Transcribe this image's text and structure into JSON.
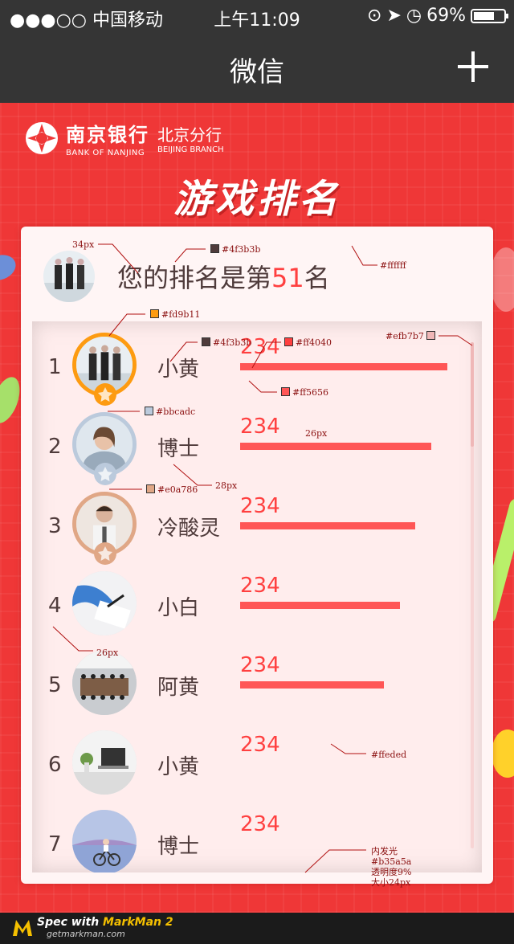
{
  "status_bar": {
    "carrier": "●●●○○ 中国移动",
    "time": "上午11:09",
    "battery": "69%",
    "battery_level": 0.69
  },
  "nav": {
    "title": "微信"
  },
  "bank": {
    "name_cn": "南京银行",
    "name_en": "BANK OF NANJING",
    "branch_cn": "北京分行",
    "branch_en": "BEIJING BRANCH"
  },
  "page_title": "游戏排名",
  "my_rank": {
    "prefix": "您的排名是第",
    "rank": "51",
    "suffix": "名"
  },
  "ranking": [
    {
      "rank": "1",
      "name": "小黄",
      "score": "234",
      "bar_fraction": 0.92,
      "medal": "gold"
    },
    {
      "rank": "2",
      "name": "博士",
      "score": "234",
      "bar_fraction": 0.85,
      "medal": "silver"
    },
    {
      "rank": "3",
      "name": "冷酸灵",
      "score": "234",
      "bar_fraction": 0.78,
      "medal": "bronze"
    },
    {
      "rank": "4",
      "name": "小白",
      "score": "234",
      "bar_fraction": 0.71,
      "medal": ""
    },
    {
      "rank": "5",
      "name": "阿黄",
      "score": "234",
      "bar_fraction": 0.64,
      "medal": ""
    },
    {
      "rank": "6",
      "name": "小黄",
      "score": "234",
      "bar_fraction": 0,
      "medal": ""
    },
    {
      "rank": "7",
      "name": "博士",
      "score": "234",
      "bar_fraction": 0,
      "medal": ""
    }
  ],
  "colors": {
    "text": "#4f3b3b",
    "score": "#ff4040",
    "bar": "#ff5656",
    "panel": "#ffffff",
    "list_bg": "#ffeded",
    "scrollbar": "#efb7b7",
    "gold": "#fd9b11",
    "silver": "#bbcadc",
    "bronze": "#e0a786"
  },
  "annotations": {
    "a_34px": "34px",
    "a_4f3b3b_1": "#4f3b3b",
    "a_ffffff": "#ffffff",
    "a_fd9b11": "#fd9b11",
    "a_4f3b3b_2": "#4f3b3b",
    "a_ff4040": "#ff4040",
    "a_efb7b7": "#efb7b7",
    "a_ff5656": "#ff5656",
    "a_bbcadc": "#bbcadc",
    "a_26px_1": "26px",
    "a_e0a786": "#e0a786",
    "a_28px": "28px",
    "a_26px_2": "26px",
    "a_ffeded": "#ffeded",
    "inner_glow_1": "内发光",
    "inner_glow_2": "#b35a5a",
    "inner_glow_3": "透明度9%",
    "inner_glow_4": "大小24px"
  },
  "footer": {
    "brand_prefix": "Spec with ",
    "brand": "MarkMan 2",
    "url": "getmarkman.com"
  }
}
